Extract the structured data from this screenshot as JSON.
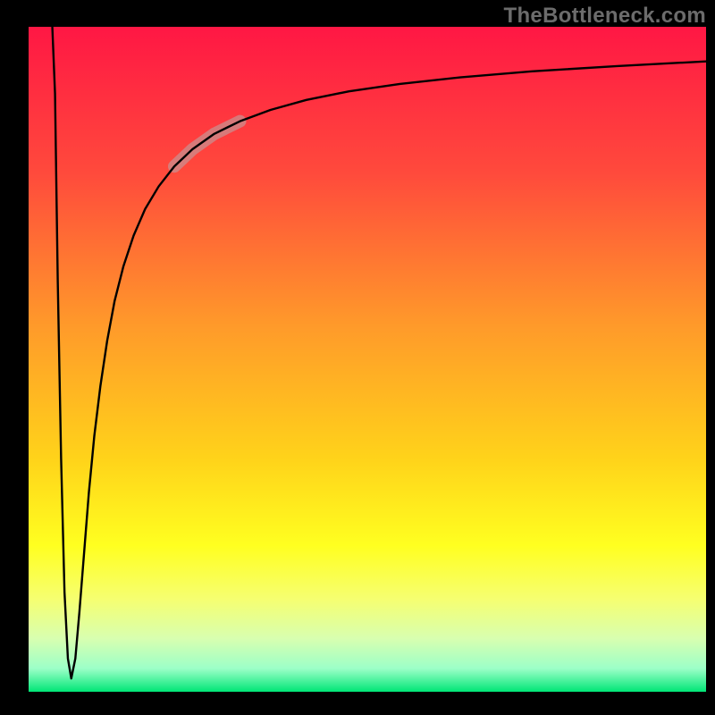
{
  "watermark": "TheBottleneck.com",
  "chart_data": {
    "type": "line",
    "title": "",
    "xlabel": "",
    "ylabel": "",
    "xlim": [
      0,
      100
    ],
    "ylim": [
      0,
      100
    ],
    "grid": false,
    "legend": false,
    "background_gradient": {
      "type": "vertical",
      "stops": [
        {
          "pos": 0.0,
          "color": "#ff1744"
        },
        {
          "pos": 0.22,
          "color": "#ff4a3c"
        },
        {
          "pos": 0.45,
          "color": "#ff9a2a"
        },
        {
          "pos": 0.65,
          "color": "#ffd31a"
        },
        {
          "pos": 0.78,
          "color": "#ffff20"
        },
        {
          "pos": 0.86,
          "color": "#f6ff70"
        },
        {
          "pos": 0.92,
          "color": "#d8ffb0"
        },
        {
          "pos": 0.965,
          "color": "#9cffc8"
        },
        {
          "pos": 1.0,
          "color": "#00e676"
        }
      ]
    },
    "series": [
      {
        "name": "bottleneck-curve",
        "color": "#000000",
        "stroke_width": 2.4,
        "x": [
          3.5,
          3.9,
          4.3,
          4.8,
          5.3,
          5.8,
          6.3,
          6.9,
          7.5,
          8.2,
          8.9,
          9.7,
          10.6,
          11.6,
          12.7,
          14.0,
          15.5,
          17.2,
          19.2,
          21.5,
          24.2,
          27.4,
          31.2,
          35.7,
          41.0,
          47.3,
          54.8,
          63.7,
          74.3,
          86.9,
          100.0
        ],
        "y": [
          100.0,
          90.0,
          62.0,
          35.0,
          15.0,
          5.0,
          2.0,
          5.0,
          12.0,
          21.0,
          30.0,
          38.5,
          46.0,
          52.8,
          58.8,
          64.0,
          68.6,
          72.6,
          76.0,
          79.0,
          81.6,
          83.9,
          85.8,
          87.5,
          89.0,
          90.3,
          91.4,
          92.4,
          93.3,
          94.1,
          94.8
        ]
      },
      {
        "name": "highlighted-segment",
        "color": "#c98f8f",
        "opacity": 0.75,
        "stroke_width": 14,
        "linecap": "round",
        "x": [
          21.5,
          24.2,
          27.4,
          31.2
        ],
        "y": [
          79.0,
          81.6,
          83.9,
          85.8
        ]
      }
    ]
  }
}
